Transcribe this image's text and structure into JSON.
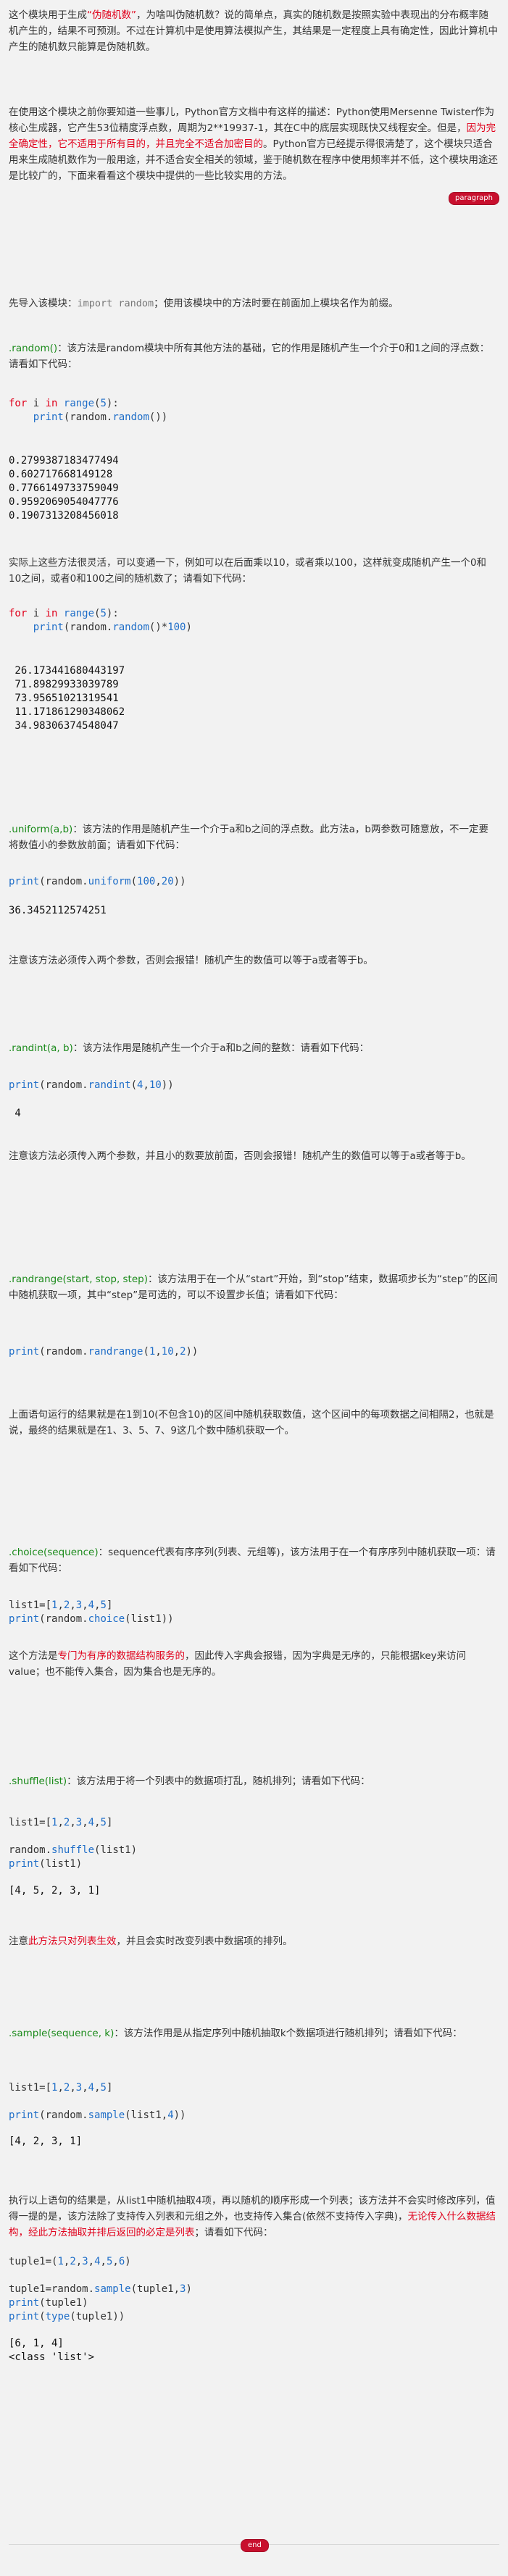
{
  "intro": {
    "p1a": "这个模块用于生成",
    "p1b": "“伪随机数”",
    "p1c": "，为啥叫伪随机数？说的简单点，真实的随机数是按照实验中表现出的分布概率随机产生的，结果不可预测。不过在计算机中是使用算法模拟产生，其结果是一定程度上具有确定性，因此计算机中产生的随机数只能算是伪随机数。",
    "p2a": "在使用这个模块之前你要知道一些事儿，Python官方文档中有这样的描述：Python使用Mersenne Twister作为核心生成器，它产生53位精度浮点数，周期为2**19937-1，其在C中的底层实现既快又线程安全。但是，",
    "p2b": "因为完全确定性，它不适用于所有目的，并且完全不适合加密目的",
    "p2c": "。Python官方已经提示得很清楚了，这个模块只适合用来生成随机数作为一般用途，并不适合安全相关的领域，鉴于随机数在程序中使用频率并不低，这个模块用途还是比较广的，下面来看看这个模块中提供的一些比较实用的方法。",
    "badge": "paragraph"
  },
  "import_line": {
    "a": "先导入该模块：",
    "b": "import random",
    "c": "；使用该模块中的方法时要在前面加上模块名作为前缀。"
  },
  "random": {
    "name": ".random()",
    "desc": "：该方法是random模块中所有其他方法的基础，它的作用是随机产生一个介于0和1之间的浮点数：请看如下代码：",
    "output": "0.2799387183477494\n0.602717668149128\n0.7766149733759049\n0.9592069054047776\n0.1907313208456018",
    "desc2": "实际上这些方法很灵活，可以变通一下，例如可以在后面乘以10，或者乘以100，这样就变成随机产生一个0和10之间，或者0和100之间的随机数了；请看如下代码：",
    "output2": " 26.173441680443197\n 71.89829933039789\n 73.95651021319541\n 11.171861290348062\n 34.98306374548047"
  },
  "uniform": {
    "name": ".uniform(a,b)",
    "desc": "：该方法的作用是随机产生一个介于a和b之间的浮点数。此方法a，b两参数可随意放，不一定要将数值小的参数放前面；请看如下代码：",
    "output": "36.3452112574251",
    "note": "注意该方法必须传入两个参数，否则会报错！随机产生的数值可以等于a或者等于b。"
  },
  "randint": {
    "name": ".randint(a, b)",
    "desc": "：该方法作用是随机产生一个介于a和b之间的整数：请看如下代码：",
    "output": " 4",
    "note": "注意该方法必须传入两个参数，并且小的数要放前面，否则会报错！随机产生的数值可以等于a或者等于b。"
  },
  "randrange": {
    "name": ".randrange(start, stop, step)",
    "desc": "：该方法用于在一个从“start”开始，到“stop”结束，数据项步长为“step”的区间中随机获取一项，其中“step”是可选的，可以不设置步长值；请看如下代码：",
    "note": "上面语句运行的结果就是在1到10(不包含10)的区间中随机获取数值，这个区间中的每项数据之间相隔2，也就是说，最终的结果就是在1、3、5、7、9这几个数中随机获取一个。"
  },
  "choice": {
    "name": ".choice(sequence)",
    "desc": "：sequence代表有序序列(列表、元组等)，该方法用于在一个有序序列中随机获取一项：请看如下代码：",
    "note_a": "这个方法是",
    "note_b": "专门为有序的数据结构服务的",
    "note_c": "，因此传入字典会报错，因为字典是无序的，只能根据key来访问value；也不能传入集合，因为集合也是无序的。"
  },
  "shuffle": {
    "name": ".shuffle(list)",
    "desc": "：该方法用于将一个列表中的数据项打乱，随机排列；请看如下代码：",
    "output": "[4, 5, 2, 3, 1]",
    "note_a": "注意",
    "note_b": "此方法只对列表生效",
    "note_c": "，并且会实时改变列表中数据项的排列。"
  },
  "sample": {
    "name": ".sample(sequence, k)",
    "desc": "：该方法作用是从指定序列中随机抽取k个数据项进行随机排列；请看如下代码：",
    "output": "[4, 2, 3, 1]",
    "note_a": "执行以上语句的结果是，从list1中随机抽取4项，再以随机的顺序形成一个列表；该方法并不会实时修改序列，值得一提的是，该方法除了支持传入列表和元组之外，也支持传入集合(依然不支持传入字典)，",
    "note_b": "无论传入什么数据结构，经此方法抽取并排后返回的必定是列表",
    "note_c": "；请看如下代码：",
    "output2": "[6, 1, 4]\n<class 'list'>"
  },
  "end_badge": "end"
}
